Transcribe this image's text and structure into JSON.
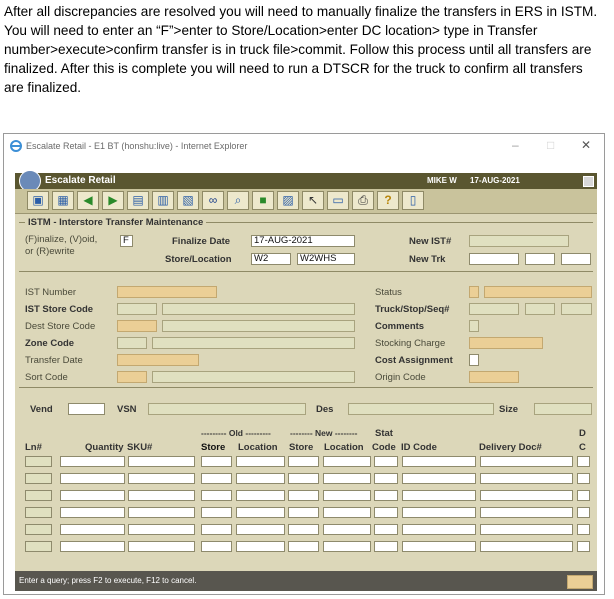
{
  "instructions": "After all discrepancies are resolved you will need to manually finalize the transfers in ERS in ISTM.  You will need to enter an “F”>enter to Store/Location>enter DC location> type in Transfer number>execute>confirm transfer is in truck file>commit.  Follow this process until all transfers are finalized.  After this is complete you will need to run a DTSCR for the truck to confirm all transfers are finalized.",
  "browser": {
    "title": "Escalate Retail - E1 BT (honshu:live) - Internet Explorer",
    "min": "–",
    "max": "□",
    "close": "✕"
  },
  "app": {
    "name": "Escalate Retail",
    "user": "MIKE W",
    "date": "17-AUG-2021"
  },
  "toolbar": {
    "icons": [
      "save-query-icon",
      "exit-icon",
      "back-arrow-icon",
      "forward-arrow-icon",
      "list-icon",
      "edit-icon",
      "note-icon",
      "binoculars-icon",
      "search-icon",
      "save-icon",
      "form-icon",
      "pointer-icon",
      "document-icon",
      "print-icon",
      "help-icon",
      "window-icon"
    ],
    "glyphs": [
      "▣",
      "▦",
      "◀",
      "▶",
      "▤",
      "▥",
      "▧",
      "∞",
      "⌕",
      "■",
      "▨",
      "↖",
      "▭",
      "⎙",
      "?",
      "▯"
    ]
  },
  "form": {
    "section_title": "ISTM - Interstore Transfer Maintenance",
    "mode_label_1": "(F)inalize, (V)oid,",
    "mode_label_2": "or (R)ewrite",
    "mode_value": "F",
    "finalize_date_label": "Finalize Date",
    "finalize_date": "17-AUG-2021",
    "store_location_label": "Store/Location",
    "store": "W2",
    "location": "W2WHS",
    "new_ist_label": "New IST#",
    "new_trk_label": "New Trk",
    "ist_number_label": "IST Number",
    "ist_store_code_label": "IST Store Code",
    "dest_store_code_label": "Dest Store Code",
    "zone_code_label": "Zone Code",
    "transfer_date_label": "Transfer Date",
    "sort_code_label": "Sort Code",
    "status_label": "Status",
    "truck_stop_seq_label": "Truck/Stop/Seq#",
    "comments_label": "Comments",
    "stocking_charge_label": "Stocking Charge",
    "cost_assignment_label": "Cost Assignment",
    "origin_code_label": "Origin Code",
    "vend_label": "Vend",
    "vsn_label": "VSN",
    "des_label": "Des",
    "size_label": "Size"
  },
  "grid": {
    "old_label": "--------- Old ---------",
    "new_label": "-------- New --------",
    "stat_label": "Stat",
    "d_label": "D",
    "columns": [
      "Ln#",
      "Quantity",
      "SKU#",
      "Store",
      "Location",
      "Store",
      "Location",
      "Code",
      "ID Code",
      "Delivery Doc#",
      "C"
    ]
  },
  "status_bar": "Enter a query; press F2 to execute, F12 to cancel."
}
